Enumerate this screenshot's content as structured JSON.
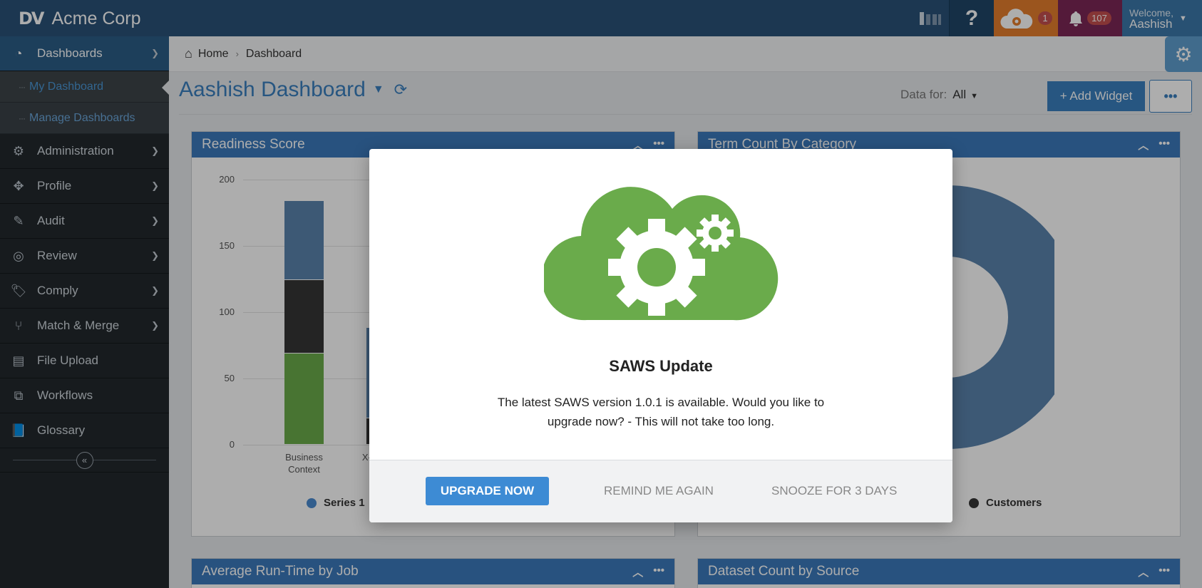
{
  "topbar": {
    "logo_mark": "DV",
    "app_name": "Acme Corp",
    "help_label": "?",
    "cloud_badge": "1",
    "bell_badge": "107",
    "welcome": "Welcome,",
    "username": "Aashish"
  },
  "sidebar": {
    "items": [
      {
        "label": "Dashboards"
      },
      {
        "label": "Administration"
      },
      {
        "label": "Profile"
      },
      {
        "label": "Audit"
      },
      {
        "label": "Review"
      },
      {
        "label": "Comply"
      },
      {
        "label": "Match & Merge"
      },
      {
        "label": "File Upload"
      },
      {
        "label": "Workflows"
      },
      {
        "label": "Glossary"
      }
    ],
    "sub_items": [
      {
        "label": "My Dashboard"
      },
      {
        "label": "Manage Dashboards"
      }
    ],
    "collapse_symbol": "«"
  },
  "breadcrumb": {
    "home": "Home",
    "current": "Dashboard"
  },
  "dashboard": {
    "title": "Aashish Dashboard",
    "data_for_label": "Data for:",
    "data_for_value": "All",
    "add_widget_label": "+ Add Widget",
    "more_label": "•••"
  },
  "widgets": {
    "readiness": "Readiness Score",
    "term_count": "Term Count By Category",
    "avg_runtime": "Average Run-Time by Job",
    "dataset_count": "Dataset Count by Source"
  },
  "chart_data": {
    "type": "bar",
    "title": "Readiness Score",
    "categories": [
      "Business Context",
      "X-Sys Integ"
    ],
    "yticks": [
      0,
      50,
      100,
      150,
      200
    ],
    "ylim": [
      0,
      200
    ],
    "series": [
      {
        "name": "Series 1",
        "values": [
          69,
          0
        ],
        "color": "#6aab4b"
      },
      {
        "name": "",
        "values": [
          55,
          20
        ],
        "color": "#353535"
      },
      {
        "name": "",
        "values": [
          60,
          68
        ],
        "color": "#5b84ad"
      }
    ]
  },
  "legend_right": "Customers",
  "modal": {
    "title": "SAWS Update",
    "text": "The latest SAWS version 1.0.1 is available. Would you like to upgrade now? - This will not take too long.",
    "upgrade": "UPGRADE NOW",
    "remind": "REMIND ME AGAIN",
    "snooze": "SNOOZE FOR 3 DAYS"
  },
  "colors": {
    "brand": "#2a5178",
    "accent": "#3b7abb",
    "cloud_green": "#6aab4b",
    "orange": "#e57e2d",
    "maroon": "#7d2756"
  }
}
